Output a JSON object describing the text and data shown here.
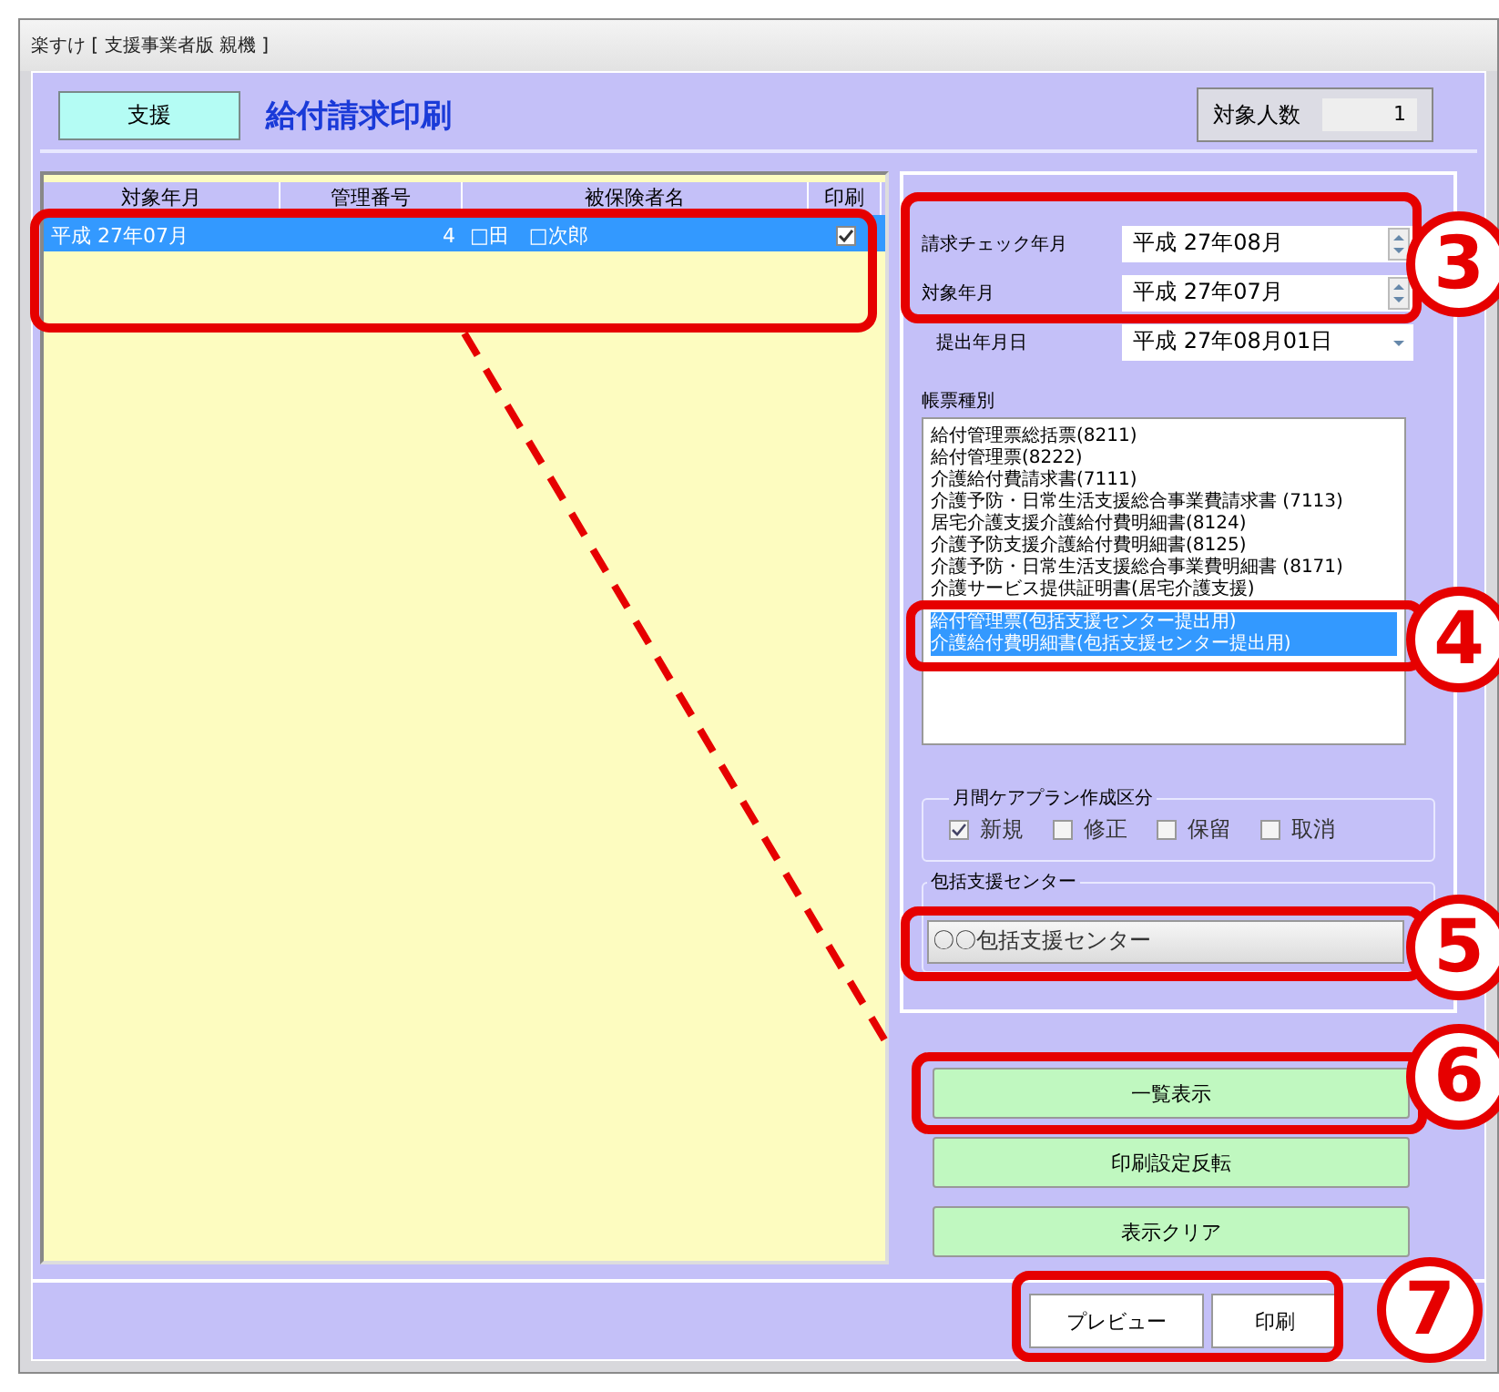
{
  "window": {
    "title": "楽すけ [ 支援事業者版 親機 ]"
  },
  "header": {
    "tag": "支援",
    "title": "給付請求印刷",
    "count_label": "対象人数",
    "count_value": "1"
  },
  "table": {
    "columns": [
      "対象年月",
      "管理番号",
      "被保険者名",
      "印刷"
    ],
    "rows": [
      {
        "cells": [
          "平成 27年07月",
          "4",
          "□田　□次郎"
        ],
        "print_checked": true,
        "selected": true
      }
    ]
  },
  "fields": [
    {
      "label": "請求チェック年月",
      "value": "平成 27年08月",
      "kind": "spin"
    },
    {
      "label": "対象年月",
      "value": "平成 27年07月",
      "kind": "spin"
    },
    {
      "label": "提出年月日",
      "value": "平成 27年08月01日",
      "kind": "dropdown"
    }
  ],
  "form_types": {
    "label": "帳票種別",
    "items": [
      {
        "label": "給付管理票総括票(8211)",
        "selected": false
      },
      {
        "label": "給付管理票(8222)",
        "selected": false
      },
      {
        "label": "介護給付費請求書(7111)",
        "selected": false
      },
      {
        "label": "介護予防・日常生活支援総合事業費請求書 (7113)",
        "selected": false
      },
      {
        "label": "居宅介護支援介護給付費明細書(8124)",
        "selected": false
      },
      {
        "label": "介護予防支援介護給付費明細書(8125)",
        "selected": false
      },
      {
        "label": "介護予防・日常生活支援総合事業費明細書 (8171)",
        "selected": false
      },
      {
        "label": "介護サービス提供証明書(居宅介護支援)",
        "selected": false
      },
      {
        "label": "給付管理票(包括支援センター提出用)",
        "selected": true
      },
      {
        "label": "介護給付費明細書(包括支援センター提出用)",
        "selected": true
      }
    ]
  },
  "care_plan": {
    "label": "月間ケアプラン作成区分",
    "options": [
      {
        "label": "新規",
        "checked": true
      },
      {
        "label": "修正",
        "checked": false
      },
      {
        "label": "保留",
        "checked": false
      },
      {
        "label": "取消",
        "checked": false
      }
    ]
  },
  "center": {
    "label": "包括支援センター",
    "value": "〇〇包括支援センター"
  },
  "action_buttons": [
    "一覧表示",
    "印刷設定反転",
    "表示クリア"
  ],
  "footer_buttons": [
    "プレビュー",
    "印刷"
  ],
  "annotations": [
    {
      "number": "3"
    },
    {
      "number": "4"
    },
    {
      "number": "5"
    },
    {
      "number": "6"
    },
    {
      "number": "7"
    }
  ]
}
